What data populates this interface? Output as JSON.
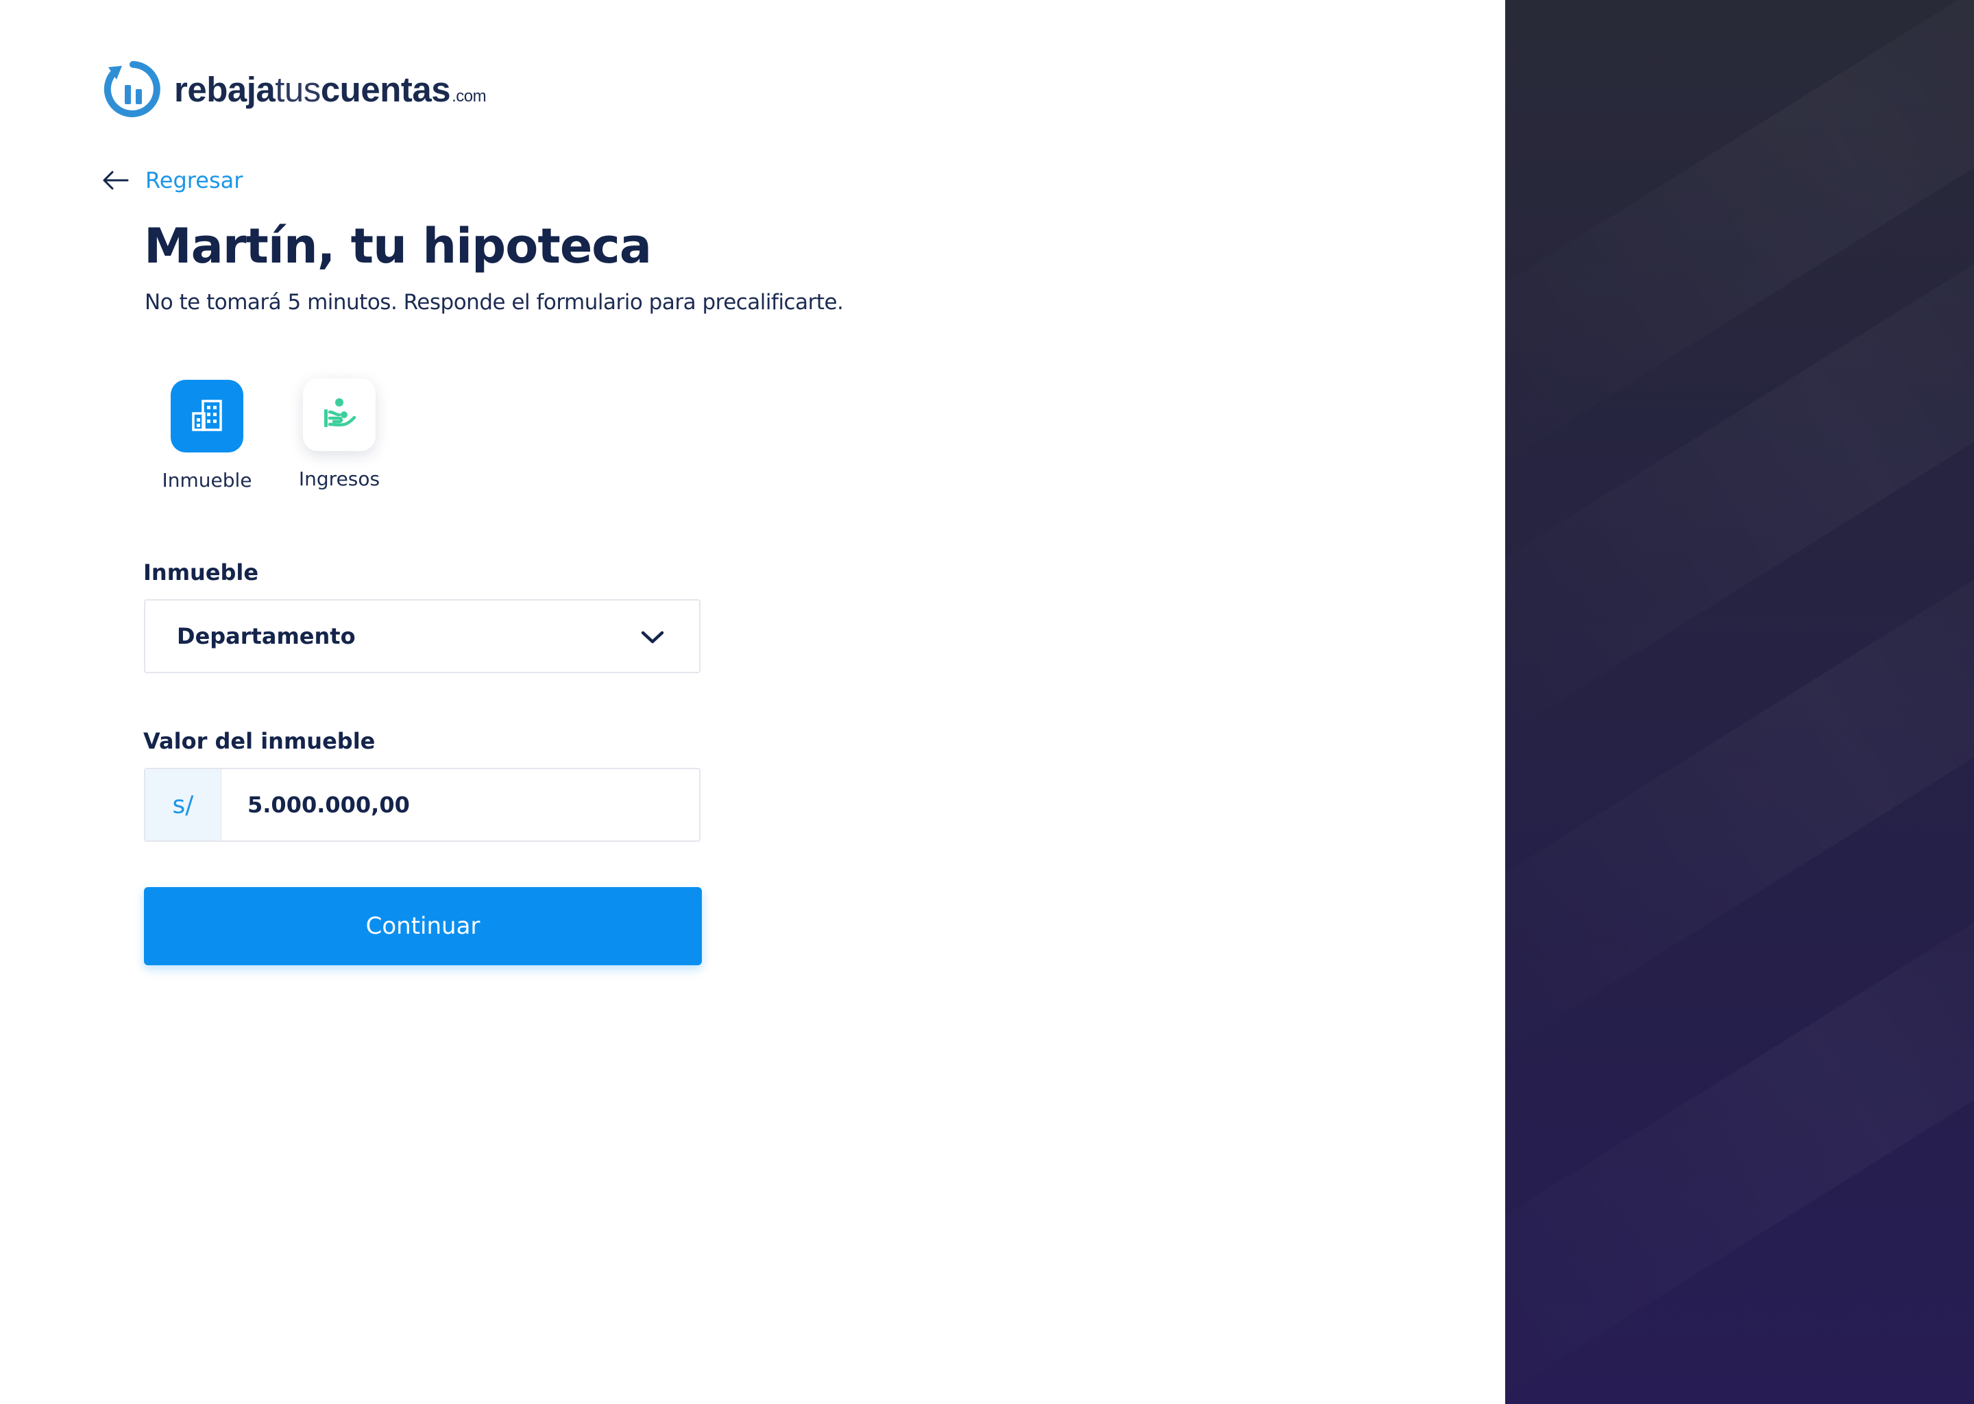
{
  "brand": {
    "logo_parts": [
      "rebaja",
      "tus",
      "cuentas",
      ".com"
    ],
    "logo_full": "rebajatuscuentas.com",
    "colors": {
      "primary": "#0a8ff0",
      "link": "#1b96e6",
      "text": "#14244b",
      "accent_green": "#3ccf9c",
      "dark_panel": "#262440"
    }
  },
  "nav": {
    "back_label": "Regresar",
    "back_icon": "arrow-left-icon"
  },
  "header": {
    "title": "Martín, tu hipoteca",
    "subtitle": "No te tomará 5 minutos. Responde el formulario para precalificarte."
  },
  "steps": [
    {
      "label": "Inmueble",
      "icon": "building-icon",
      "active": true
    },
    {
      "label": "Ingresos",
      "icon": "income-hand-icon",
      "active": false
    }
  ],
  "form": {
    "property_label": "Inmueble",
    "property_value": "Departamento",
    "value_label": "Valor del inmueble",
    "currency_symbol": "s/",
    "value_amount": "5.000.000,00"
  },
  "actions": {
    "continue_label": "Continuar"
  }
}
